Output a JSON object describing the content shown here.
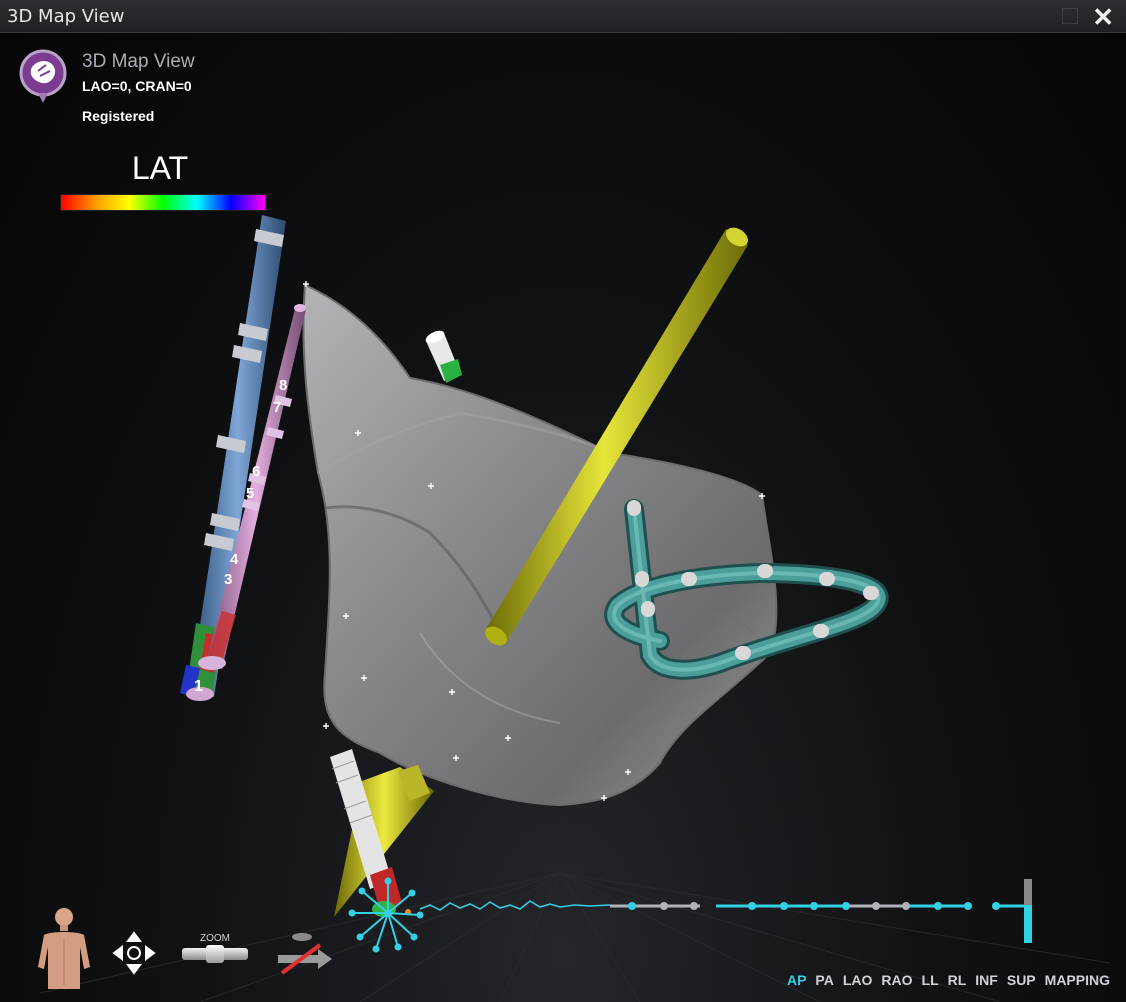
{
  "window": {
    "title": "3D Map View",
    "close_glyph": "✕"
  },
  "overlay": {
    "title": "3D Map View",
    "view_angle": "LAO=0, CRAN=0",
    "status": "Registered",
    "colorbar_label": "LAT"
  },
  "catheter_labels": {
    "blue_tip": "1",
    "pink_electrodes": [
      "8",
      "7",
      "6",
      "5",
      "4",
      "3"
    ]
  },
  "toolbar": {
    "zoom_label": "ZOOM",
    "icons": [
      "patient-body-icon",
      "pan-arrows-icon",
      "zoom-slider-icon",
      "projection-toggle-icon"
    ]
  },
  "view_buttons": [
    {
      "label": "AP",
      "active": true
    },
    {
      "label": "PA",
      "active": false
    },
    {
      "label": "LAO",
      "active": false
    },
    {
      "label": "RAO",
      "active": false
    },
    {
      "label": "LL",
      "active": false
    },
    {
      "label": "RL",
      "active": false
    },
    {
      "label": "INF",
      "active": false
    },
    {
      "label": "SUP",
      "active": false
    },
    {
      "label": "MAPPING",
      "active": false
    }
  ],
  "colors": {
    "accent": "#33d1e6",
    "heart_mesh": "#8e8e90",
    "yellow_catheter": "#c8c81e",
    "blue_catheter": "#5d86b8",
    "pink_catheter": "#c98fc4",
    "teal_catheter": "#3f8e8c"
  }
}
